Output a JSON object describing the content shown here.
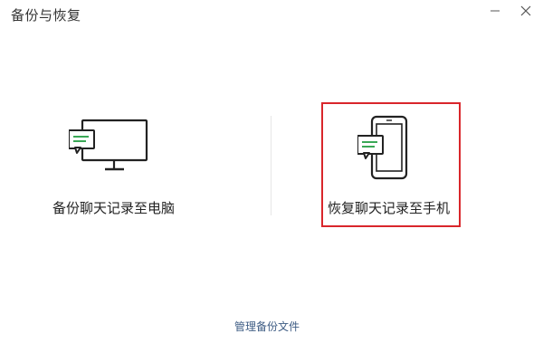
{
  "window": {
    "title": "备份与恢复"
  },
  "options": {
    "backup_label": "备份聊天记录至电脑",
    "restore_label": "恢复聊天记录至手机"
  },
  "footer": {
    "manage_link": "管理备份文件"
  },
  "colors": {
    "highlight_border": "#d9262b",
    "chat_bubble_green": "#3aa856",
    "icon_stroke": "#222222",
    "link": "#3e5c84"
  },
  "icons": {
    "computer": "monitor-icon",
    "phone": "phone-icon",
    "message": "chat-bubble-icon",
    "minimize": "minimize-icon",
    "close": "close-icon"
  }
}
